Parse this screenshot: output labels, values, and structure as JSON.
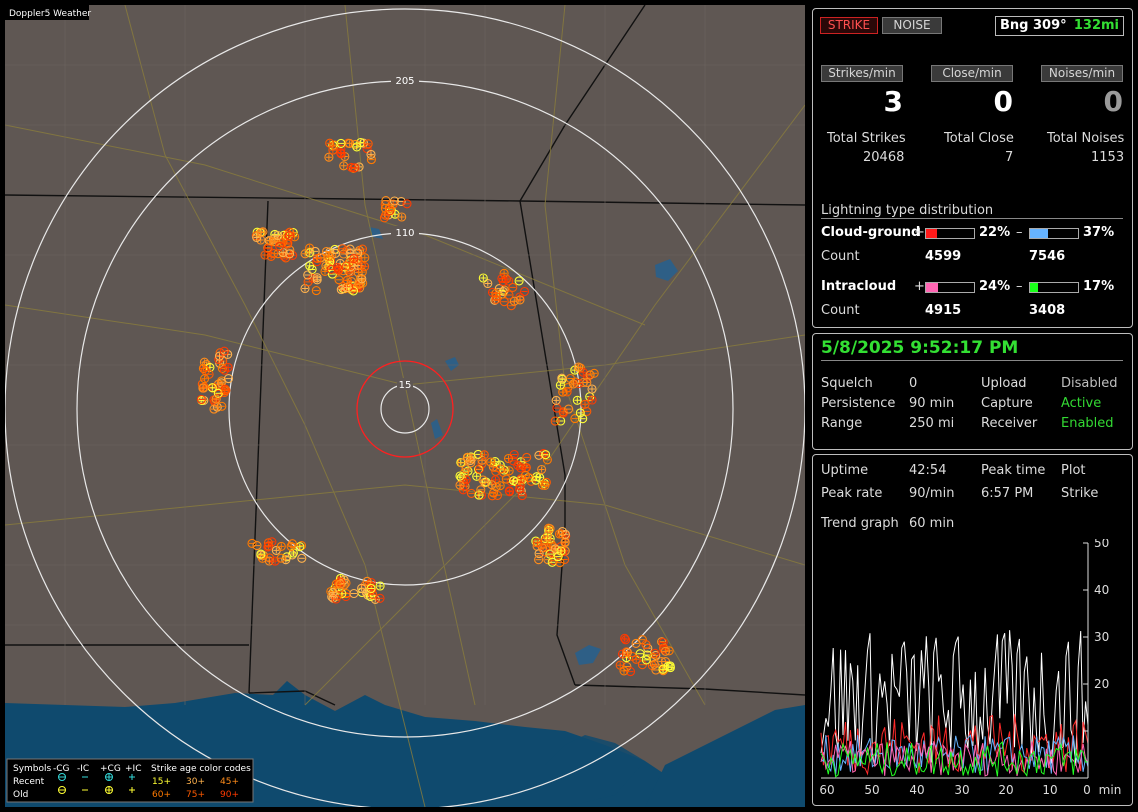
{
  "window_title": "Doppler5 Weather",
  "map": {
    "ring_labels": [
      "205",
      "110",
      "15"
    ],
    "legend": {
      "header": [
        "Symbols",
        "-CG",
        "-IC",
        "+CG",
        "+IC"
      ],
      "age_title": "Strike age color codes",
      "rows": [
        {
          "label": "Recent",
          "ages": [
            "15+",
            "30+",
            "45+"
          ]
        },
        {
          "label": "Old",
          "ages": [
            "60+",
            "75+",
            "90+"
          ]
        }
      ],
      "age_colors": [
        "#ffff33",
        "#ffb24d",
        "#ff8c1a",
        "#ff7a00",
        "#ff5a00",
        "#ff3a00"
      ]
    }
  },
  "top": {
    "strike_label": "STRIKE",
    "noise_label": "NOISE",
    "bearing": "Bng 309°",
    "distance": "132mi",
    "rates": [
      {
        "label": "Strikes/min",
        "value": "3"
      },
      {
        "label": "Close/min",
        "value": "0"
      },
      {
        "label": "Noises/min",
        "value": "0"
      }
    ],
    "totals": [
      {
        "label": "Total Strikes",
        "value": "20468"
      },
      {
        "label": "Total Close",
        "value": "7"
      },
      {
        "label": "Total Noises",
        "value": "1153"
      }
    ],
    "dist_title": "Lightning type distribution",
    "cloud_ground": {
      "label": "Cloud-ground",
      "pos_sign": "+",
      "pos_pct": "22%",
      "pos_frac": 0.22,
      "neg_sign": "–",
      "neg_pct": "37%",
      "neg_frac": 0.37,
      "count_label": "Count",
      "pos_count": "4599",
      "neg_count": "7546"
    },
    "intracloud": {
      "label": "Intracloud",
      "pos_sign": "+",
      "pos_pct": "24%",
      "pos_frac": 0.24,
      "neg_sign": "–",
      "neg_pct": "17%",
      "neg_frac": 0.17,
      "count_label": "Count",
      "pos_count": "4915",
      "neg_count": "3408"
    },
    "colors": {
      "cg_pos": "#ff1a1a",
      "cg_neg": "#66b3ff",
      "ic_pos": "#ff66b3",
      "ic_neg": "#1aff1a"
    }
  },
  "status": {
    "datetime": "5/8/2025 9:52:17 PM",
    "rows": [
      {
        "k1": "Squelch",
        "v1": "0",
        "k2": "Upload",
        "v2": "Disabled"
      },
      {
        "k1": "Persistence",
        "v1": "90 min",
        "k2": "Capture",
        "v2": "Active"
      },
      {
        "k1": "Range",
        "v1": "250 mi",
        "k2": "Receiver",
        "v2": "Enabled"
      }
    ]
  },
  "trend": {
    "uptime_label": "Uptime",
    "uptime": "42:54",
    "peak_time_label": "Peak time",
    "plot_label": "Plot",
    "peak_rate_label": "Peak rate",
    "peak_rate": "90/min",
    "peak_time": "6:57 PM",
    "plot": "Strike",
    "graph_label": "Trend graph",
    "graph_span": "60 min",
    "y_ticks": [
      "50",
      "40",
      "30",
      "20"
    ],
    "x_ticks": [
      "60",
      "50",
      "40",
      "30",
      "20",
      "10",
      "0"
    ],
    "x_unit": "min"
  }
}
